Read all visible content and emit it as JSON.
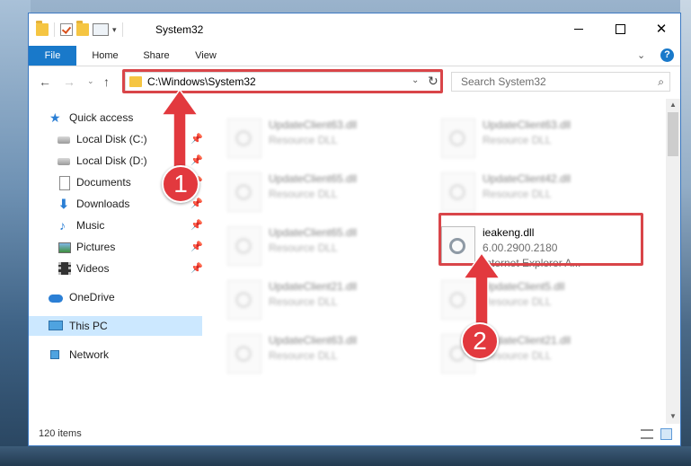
{
  "window": {
    "title": "System32",
    "controls": {
      "minimize": "minimize",
      "maximize": "maximize",
      "close": "✕"
    }
  },
  "ribbon": {
    "tabs": [
      {
        "label": "File"
      },
      {
        "label": "Home"
      },
      {
        "label": "Share"
      },
      {
        "label": "View"
      }
    ],
    "help": "?"
  },
  "nav": {
    "back": "←",
    "forward": "→",
    "recent": "⌄",
    "up": "↑",
    "address": "C:\\Windows\\System32",
    "refresh": "↻",
    "search_placeholder": "Search System32"
  },
  "sidebar": {
    "items": [
      {
        "label": "Quick access",
        "icon": "quick-access-star-icon"
      },
      {
        "label": "Local Disk (C:)",
        "icon": "drive-icon",
        "pinned": true
      },
      {
        "label": "Local Disk (D:)",
        "icon": "drive-icon",
        "pinned": true
      },
      {
        "label": "Documents",
        "icon": "documents-icon",
        "pinned": true
      },
      {
        "label": "Downloads",
        "icon": "downloads-icon",
        "pinned": true
      },
      {
        "label": "Music",
        "icon": "music-icon",
        "pinned": true
      },
      {
        "label": "Pictures",
        "icon": "pictures-icon",
        "pinned": true
      },
      {
        "label": "Videos",
        "icon": "videos-icon",
        "pinned": true
      },
      {
        "label": "OneDrive",
        "icon": "onedrive-icon"
      },
      {
        "label": "This PC",
        "icon": "this-pc-icon",
        "selected": true
      },
      {
        "label": "Network",
        "icon": "network-icon"
      }
    ]
  },
  "files": [
    {
      "name": "UpdateClient63.dll",
      "sub": "Resource DLL",
      "blurred": true
    },
    {
      "name": "UpdateClient63.dll",
      "sub": "Resource DLL",
      "blurred": true
    },
    {
      "name": "UpdateClient65.dll",
      "sub": "Resource DLL",
      "blurred": true
    },
    {
      "name": "UpdateClient42.dll",
      "sub": "Resource DLL",
      "blurred": true
    },
    {
      "name": "UpdateClient65.dll",
      "sub": "Resource DLL",
      "blurred": true
    },
    {
      "name": "ieakeng.dll",
      "version": "6.00.2900.2180",
      "description": "Internet Explorer A...",
      "blurred": false
    },
    {
      "name": "UpdateClient21.dll",
      "sub": "Resource DLL",
      "blurred": true
    },
    {
      "name": "UpdateClient5.dll",
      "sub": "Resource DLL",
      "blurred": true
    },
    {
      "name": "UpdateClient63.dll",
      "sub": "Resource DLL",
      "blurred": true
    },
    {
      "name": "UpdateClient21.dll",
      "sub": "Resource DLL",
      "blurred": true
    }
  ],
  "status": {
    "item_count": "120 items"
  },
  "annotations": {
    "step1": "1",
    "step2": "2",
    "color": "#e2393e"
  },
  "colors": {
    "accent": "#1979ca",
    "highlight": "#d94549",
    "selection": "#cce8ff"
  }
}
